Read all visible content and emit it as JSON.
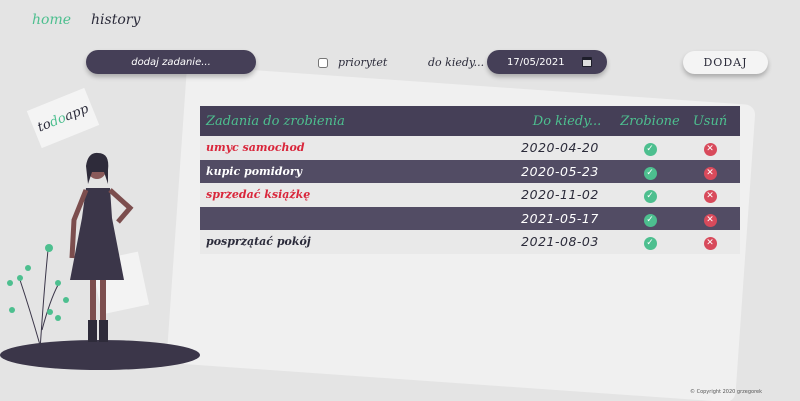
{
  "nav": {
    "home": "home",
    "history": "history"
  },
  "form": {
    "task_placeholder": "dodaj zadanie...",
    "priority_label": "priorytet",
    "due_label": "do kiedy...",
    "date_value": "17/05/2021",
    "add_button": "DODAJ"
  },
  "logo": {
    "pre": "to",
    "mid": "do",
    "post": "app"
  },
  "table": {
    "headers": {
      "name": "Zadania do zrobienia",
      "due": "Do kiedy...",
      "done": "Zrobione",
      "delete": "Usuń"
    },
    "rows": [
      {
        "name": "umyc samochod",
        "due": "2020-04-20"
      },
      {
        "name": "kupic pomidory",
        "due": "2020-05-23"
      },
      {
        "name": "sprzedać książkę",
        "due": "2020-11-02"
      },
      {
        "name": "",
        "due": "2021-05-17"
      },
      {
        "name": "posprzątać pokój",
        "due": "2021-08-03"
      }
    ]
  },
  "colors": {
    "accent": "#4dbf8f",
    "dark": "#453f57",
    "priority_red": "#d9263b"
  },
  "footer": {
    "copyright": "© Copyright 2020 grzegorek"
  }
}
